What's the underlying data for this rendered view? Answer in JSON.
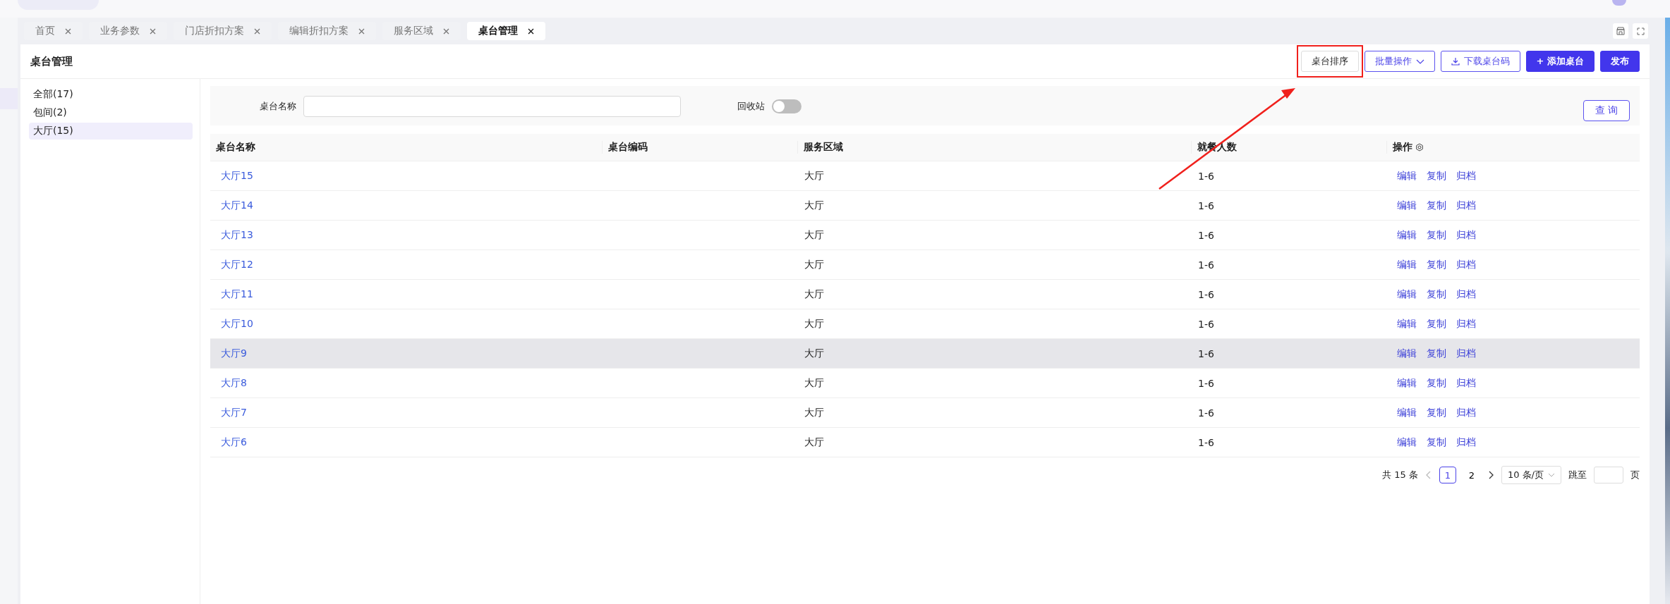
{
  "tabs": [
    {
      "label": "首页",
      "selected": false
    },
    {
      "label": "业务参数",
      "selected": false
    },
    {
      "label": "门店折扣方案",
      "selected": false
    },
    {
      "label": "编辑折扣方案",
      "selected": false
    },
    {
      "label": "服务区域",
      "selected": false
    },
    {
      "label": "桌台管理",
      "selected": true
    }
  ],
  "page_title": "桌台管理",
  "toolbar": [
    {
      "label": "桌台排序",
      "kind": "plain",
      "annotated": true
    },
    {
      "label": "批量操作",
      "kind": "dropdown",
      "annotated": false
    },
    {
      "label": "下载桌台码",
      "kind": "download",
      "annotated": false
    },
    {
      "label": "+ 添加桌台",
      "kind": "primary",
      "annotated": false
    },
    {
      "label": "发布",
      "kind": "primary",
      "annotated": false
    }
  ],
  "sidebar": {
    "items": [
      {
        "label": "全部(17)",
        "selected": false
      },
      {
        "label": "包间(2)",
        "selected": false
      },
      {
        "label": "大厅(15)",
        "selected": true
      }
    ]
  },
  "filters": {
    "name_label": "桌台名称",
    "recycle_label": "回收站",
    "recycle_on": false,
    "query_button": "查 询"
  },
  "table": {
    "columns": [
      "桌台名称",
      "桌台编码",
      "服务区域",
      "就餐人数",
      "操作"
    ],
    "rows": [
      {
        "name": "大厅15",
        "area": "大厅",
        "guests": "1-6",
        "actions": [
          "编辑",
          "复制",
          "归档"
        ],
        "selected": false
      },
      {
        "name": "大厅14",
        "area": "大厅",
        "guests": "1-6",
        "actions": [
          "编辑",
          "复制",
          "归档"
        ],
        "selected": false
      },
      {
        "name": "大厅13",
        "area": "大厅",
        "guests": "1-6",
        "actions": [
          "编辑",
          "复制",
          "归档"
        ],
        "selected": false
      },
      {
        "name": "大厅12",
        "area": "大厅",
        "guests": "1-6",
        "actions": [
          "编辑",
          "复制",
          "归档"
        ],
        "selected": false
      },
      {
        "name": "大厅11",
        "area": "大厅",
        "guests": "1-6",
        "actions": [
          "编辑",
          "复制",
          "归档"
        ],
        "selected": false
      },
      {
        "name": "大厅10",
        "area": "大厅",
        "guests": "1-6",
        "actions": [
          "编辑",
          "复制",
          "归档"
        ],
        "selected": false
      },
      {
        "name": "大厅9",
        "area": "大厅",
        "guests": "1-6",
        "actions": [
          "编辑",
          "复制",
          "归档"
        ],
        "selected": true
      },
      {
        "name": "大厅8",
        "area": "大厅",
        "guests": "1-6",
        "actions": [
          "编辑",
          "复制",
          "归档"
        ],
        "selected": false
      },
      {
        "name": "大厅7",
        "area": "大厅",
        "guests": "1-6",
        "actions": [
          "编辑",
          "复制",
          "归档"
        ],
        "selected": false
      },
      {
        "name": "大厅6",
        "area": "大厅",
        "guests": "1-6",
        "actions": [
          "编辑",
          "复制",
          "归档"
        ],
        "selected": false
      }
    ]
  },
  "pagination": {
    "total": "共 15 条",
    "pages": [
      {
        "label": "1",
        "selected": true
      },
      {
        "label": "2",
        "selected": false
      }
    ],
    "page_size": "10 条/页",
    "jump_label": "跳至",
    "page_unit": "页"
  }
}
